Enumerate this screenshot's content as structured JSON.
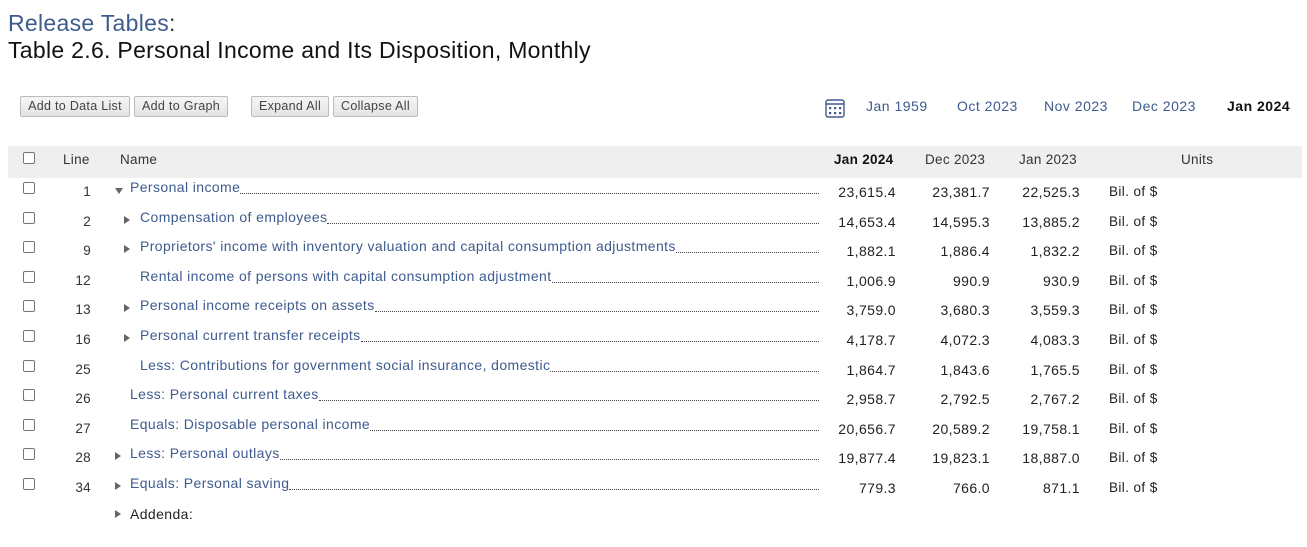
{
  "breadcrumb": {
    "label": "Release Tables",
    "colon": ":"
  },
  "title": "Table 2.6. Personal Income and Its Disposition, Monthly",
  "toolbar": {
    "add_data_list": "Add to Data List",
    "add_graph": "Add to Graph",
    "expand_all": "Expand All",
    "collapse_all": "Collapse All"
  },
  "dates": [
    "Jan 1959",
    "Oct 2023",
    "Nov 2023",
    "Dec 2023",
    "Jan 2024"
  ],
  "selected_date": "Jan 2024",
  "headers": {
    "line": "Line",
    "name": "Name",
    "col1": "Jan 2024",
    "col2": "Dec 2023",
    "col3": "Jan 2023",
    "units": "Units"
  },
  "rows": [
    {
      "line": "1",
      "name": "Personal income",
      "values": [
        "23,615.4",
        "23,381.7",
        "22,525.3"
      ],
      "units": "Bil. of $",
      "toggle": "expanded"
    },
    {
      "line": "2",
      "name": "Compensation of employees",
      "values": [
        "14,653.4",
        "14,595.3",
        "13,885.2"
      ],
      "units": "Bil. of $",
      "toggle": "collapsed"
    },
    {
      "line": "9",
      "name": "Proprietors' income with inventory valuation and capital consumption adjustments",
      "values": [
        "1,882.1",
        "1,886.4",
        "1,832.2"
      ],
      "units": "Bil. of $",
      "toggle": "collapsed"
    },
    {
      "line": "12",
      "name": "Rental income of persons with capital consumption adjustment",
      "values": [
        "1,006.9",
        "990.9",
        "930.9"
      ],
      "units": "Bil. of $",
      "toggle": "none"
    },
    {
      "line": "13",
      "name": "Personal income receipts on assets",
      "values": [
        "3,759.0",
        "3,680.3",
        "3,559.3"
      ],
      "units": "Bil. of $",
      "toggle": "collapsed"
    },
    {
      "line": "16",
      "name": "Personal current transfer receipts",
      "values": [
        "4,178.7",
        "4,072.3",
        "4,083.3"
      ],
      "units": "Bil. of $",
      "toggle": "collapsed"
    },
    {
      "line": "25",
      "name": "Less: Contributions for government social insurance, domestic",
      "values": [
        "1,864.7",
        "1,843.6",
        "1,765.5"
      ],
      "units": "Bil. of $",
      "toggle": "none"
    },
    {
      "line": "26",
      "name": "Less: Personal current taxes",
      "values": [
        "2,958.7",
        "2,792.5",
        "2,767.2"
      ],
      "units": "Bil. of $",
      "toggle": "none"
    },
    {
      "line": "27",
      "name": "Equals: Disposable personal income",
      "values": [
        "20,656.7",
        "20,589.2",
        "19,758.1"
      ],
      "units": "Bil. of $",
      "toggle": "none"
    },
    {
      "line": "28",
      "name": "Less: Personal outlays",
      "values": [
        "19,877.4",
        "19,823.1",
        "18,887.0"
      ],
      "units": "Bil. of $",
      "toggle": "collapsed"
    },
    {
      "line": "34",
      "name": "Equals: Personal saving",
      "values": [
        "779.3",
        "766.0",
        "871.1"
      ],
      "units": "Bil. of $",
      "toggle": "collapsed"
    }
  ],
  "addenda": "Addenda:"
}
